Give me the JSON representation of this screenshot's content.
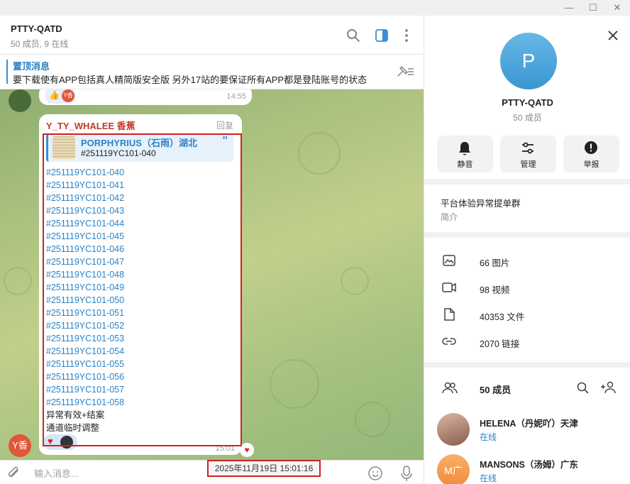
{
  "window": {
    "minimize": "—",
    "maximize": "☐",
    "close": "✕"
  },
  "chat": {
    "title": "PTTY-QATD",
    "subtitle": "50 成员, 9 在线",
    "pinned": {
      "title": "置顶消息",
      "text": "要下载使有APP包括真人精简版安全版 另外17站的要保证所有APP都是登陆账号的状态"
    },
    "prev_message_time": "14:55",
    "message": {
      "sender": "Y_TY_WHALEE 香蕉",
      "reply_label": "回复",
      "quote_name": "PORPHYRIUS（石雨）湖北",
      "quote_text": "#251119YC101-040",
      "quote_mark": "\"",
      "lines": [
        {
          "tag": "#251119YC101",
          "rest": "-040"
        },
        {
          "tag": "#251119YC101",
          "rest": "-041"
        },
        {
          "tag": "#251119YC101",
          "rest": "-042"
        },
        {
          "tag": "#251119YC101",
          "rest": "-043"
        },
        {
          "tag": "#251119YC101",
          "rest": "-044"
        },
        {
          "tag": "#251119YC101",
          "rest": "-045"
        },
        {
          "tag": "#251119YC101",
          "rest": "-046"
        },
        {
          "tag": "#251119YC101",
          "rest": "-047"
        },
        {
          "tag": "#251119YC101",
          "rest": "-048"
        },
        {
          "tag": "#251119YC101",
          "rest": "-049"
        },
        {
          "tag": "#251119YC101",
          "rest": "-050"
        },
        {
          "tag": "#251119YC101",
          "rest": "-051"
        },
        {
          "tag": "#251119YC101",
          "rest": "-052"
        },
        {
          "tag": "#251119YC101",
          "rest": "-053"
        },
        {
          "tag": "#251119YC101",
          "rest": "-054"
        },
        {
          "tag": "#251119YC101",
          "rest": "-055"
        },
        {
          "tag": "#251119YC101",
          "rest": "-056"
        },
        {
          "tag": "#251119YC101",
          "rest": "-057"
        },
        {
          "tag": "#251119YC101",
          "rest": "-058"
        }
      ],
      "footer_lines": [
        "异常有效+结案",
        "通道临时调整"
      ],
      "time": "15:01",
      "avatar": "Y香"
    },
    "prev_react_avatar": "Y香",
    "date_tooltip": "2025年11月19日 15:01:16",
    "composer_placeholder": "输入消息...",
    "colors": {
      "accent": "#3a8fd6",
      "link": "#2b83c6",
      "sender": "#c0392b",
      "highlight": "#d32020"
    }
  },
  "panel": {
    "avatar_letter": "P",
    "title": "PTTY-QATD",
    "subtitle": "50 成员",
    "actions": [
      {
        "label": "静音",
        "icon": "bell-icon"
      },
      {
        "label": "管理",
        "icon": "sliders-icon"
      },
      {
        "label": "举报",
        "icon": "alert-icon"
      }
    ],
    "description": "平台体验异常提单群",
    "description_label": "简介",
    "media": [
      {
        "label": "66 图片",
        "icon": "image-icon"
      },
      {
        "label": "98 视频",
        "icon": "video-icon"
      },
      {
        "label": "40353 文件",
        "icon": "file-icon"
      },
      {
        "label": "2070 链接",
        "icon": "link-icon"
      }
    ],
    "members_label": "50 成员",
    "members": [
      {
        "name": "HELENA（丹妮吖）天津",
        "status": "在线",
        "avatar": ""
      },
      {
        "name": "MANSONS（汤姆）广东",
        "status": "在线",
        "avatar": "M广"
      }
    ]
  }
}
